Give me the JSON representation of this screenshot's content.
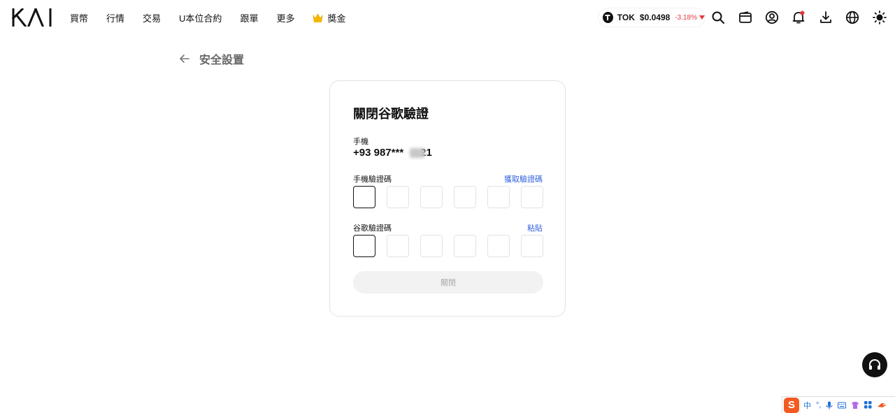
{
  "header": {
    "logo_text": "KAI",
    "nav": [
      {
        "label": "買幣"
      },
      {
        "label": "行情"
      },
      {
        "label": "交易"
      },
      {
        "label": "U本位合約"
      },
      {
        "label": "跟單"
      },
      {
        "label": "更多"
      },
      {
        "label": "獎金",
        "icon": "crown-icon"
      }
    ],
    "ticker": {
      "symbol": "TOK",
      "price": "$0.0498",
      "change": "-3.18%",
      "direction": "down"
    },
    "icons": [
      "search-icon",
      "wallet-icon",
      "user-icon",
      "bell-icon",
      "download-icon",
      "globe-icon",
      "theme-sun-icon"
    ]
  },
  "page": {
    "title": "安全設置",
    "back_icon": "arrow-left-icon"
  },
  "form": {
    "title": "關閉谷歌驗證",
    "phone_label": "手機",
    "phone_value": "+93 987***",
    "phone_tail": "21",
    "sms_code_label": "手機驗證碼",
    "sms_code_action": "獲取驗證碼",
    "google_code_label": "谷歌驗證碼",
    "google_code_action": "粘貼",
    "code_length": 6,
    "submit_label": "關閉"
  },
  "colors": {
    "accent_link": "#2f5fdc",
    "down": "#e5383b",
    "button_disabled_bg": "#f2f2f2",
    "button_disabled_text": "#a8a8a8"
  },
  "ime": {
    "logo": "S",
    "mode": "中",
    "punct": "°,",
    "icons": [
      "mic-icon",
      "keyboard-icon",
      "shirt-icon",
      "apps-icon",
      "tool-icon"
    ]
  }
}
